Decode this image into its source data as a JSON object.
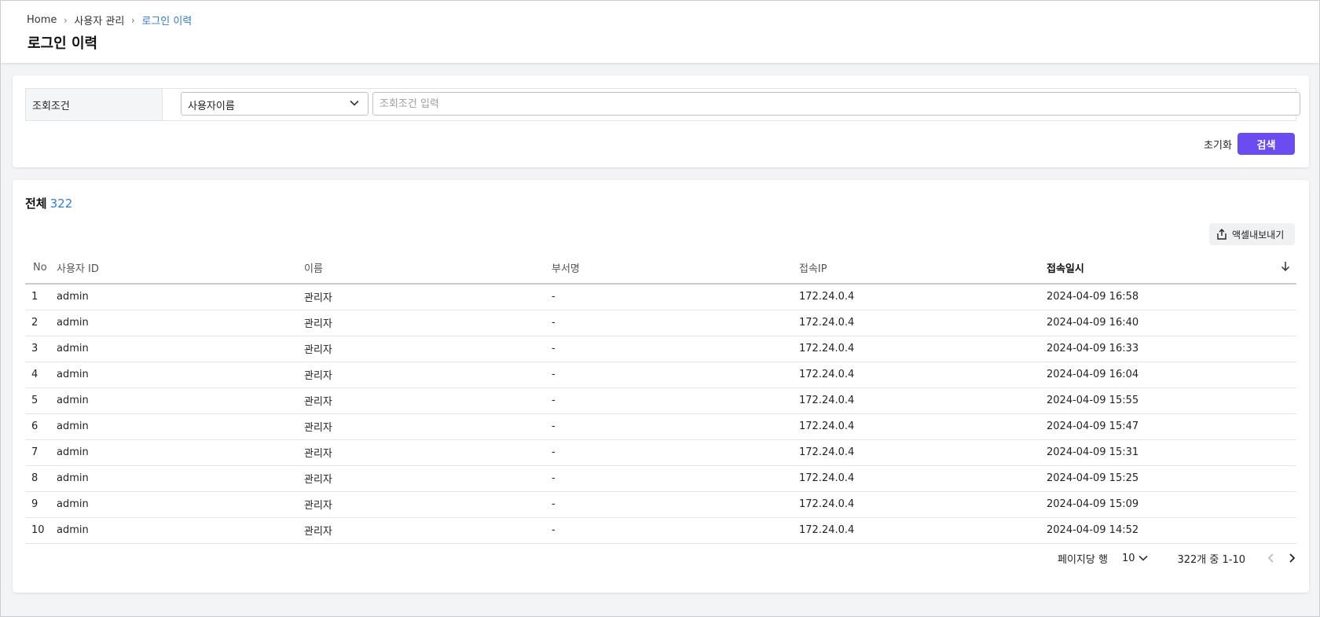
{
  "breadcrumb": {
    "items": [
      "Home",
      "사용자 관리",
      "로그인 이력"
    ]
  },
  "page": {
    "title": "로그인 이력"
  },
  "search": {
    "condition_label": "조회조건",
    "select_value": "사용자이름",
    "input_placeholder": "조회조건 입력",
    "input_value": "",
    "reset_label": "초기화",
    "search_label": "검색"
  },
  "list": {
    "total_label": "전체",
    "total_count": "322",
    "export_label": "액셀내보내기",
    "columns": [
      "No",
      "사용자 ID",
      "이름",
      "부서명",
      "접속IP",
      "접속일시"
    ],
    "rows": [
      [
        "1",
        "admin",
        "관리자",
        "-",
        "172.24.0.4",
        "2024-04-09 16:58"
      ],
      [
        "2",
        "admin",
        "관리자",
        "-",
        "172.24.0.4",
        "2024-04-09 16:40"
      ],
      [
        "3",
        "admin",
        "관리자",
        "-",
        "172.24.0.4",
        "2024-04-09 16:33"
      ],
      [
        "4",
        "admin",
        "관리자",
        "-",
        "172.24.0.4",
        "2024-04-09 16:04"
      ],
      [
        "5",
        "admin",
        "관리자",
        "-",
        "172.24.0.4",
        "2024-04-09 15:55"
      ],
      [
        "6",
        "admin",
        "관리자",
        "-",
        "172.24.0.4",
        "2024-04-09 15:47"
      ],
      [
        "7",
        "admin",
        "관리자",
        "-",
        "172.24.0.4",
        "2024-04-09 15:31"
      ],
      [
        "8",
        "admin",
        "관리자",
        "-",
        "172.24.0.4",
        "2024-04-09 15:25"
      ],
      [
        "9",
        "admin",
        "관리자",
        "-",
        "172.24.0.4",
        "2024-04-09 15:09"
      ],
      [
        "10",
        "admin",
        "관리자",
        "-",
        "172.24.0.4",
        "2024-04-09 14:52"
      ]
    ]
  },
  "pagination": {
    "rows_per_page_label": "페이지당 행",
    "rows_per_page_value": "10",
    "range_text": "322개 중 1-10"
  },
  "colors": {
    "accent": "#6a4cf0",
    "link": "#2e7ad8"
  }
}
